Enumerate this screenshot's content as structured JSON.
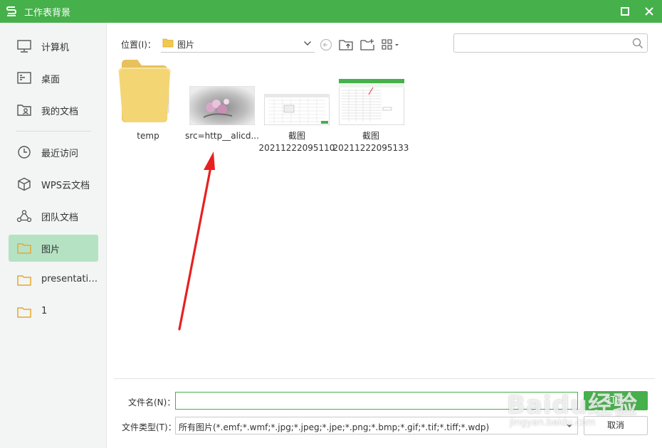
{
  "window": {
    "title": "工作表背景",
    "accent": "#46b04b"
  },
  "sidebar": {
    "items": [
      {
        "label": "计算机",
        "icon": "computer-icon"
      },
      {
        "label": "桌面",
        "icon": "desktop-icon"
      },
      {
        "label": "我的文档",
        "icon": "my-documents-icon"
      },
      {
        "label": "最近访问",
        "icon": "clock-icon"
      },
      {
        "label": "WPS云文档",
        "icon": "cloud-cube-icon"
      },
      {
        "label": "团队文档",
        "icon": "team-icon"
      },
      {
        "label": "图片",
        "icon": "folder-icon",
        "selected": true
      },
      {
        "label": "presentatio...",
        "icon": "folder-icon"
      },
      {
        "label": "1",
        "icon": "folder-icon"
      }
    ]
  },
  "location": {
    "label": "位置(I)：",
    "value": "图片"
  },
  "search": {
    "placeholder": ""
  },
  "files": [
    {
      "name": "temp",
      "type": "folder"
    },
    {
      "name": "src=http__alicd...",
      "type": "image"
    },
    {
      "name": "截图",
      "name2": "20211222095110",
      "type": "image"
    },
    {
      "name": "截图",
      "name2": "20211222095133",
      "type": "image"
    }
  ],
  "bottom": {
    "filename_label": "文件名(N)：",
    "filename_value": "",
    "filetype_label": "文件类型(T)：",
    "filetype_value": "所有图片(*.emf;*.wmf;*.jpg;*.jpeg;*.jpe;*.png;*.bmp;*.gif;*.tif;*.tiff;*.wdp)",
    "ok_label": "打开",
    "cancel_label": "取消"
  },
  "watermark": {
    "main": "Baidu经验",
    "sub": "jingyan.baidu.com"
  }
}
